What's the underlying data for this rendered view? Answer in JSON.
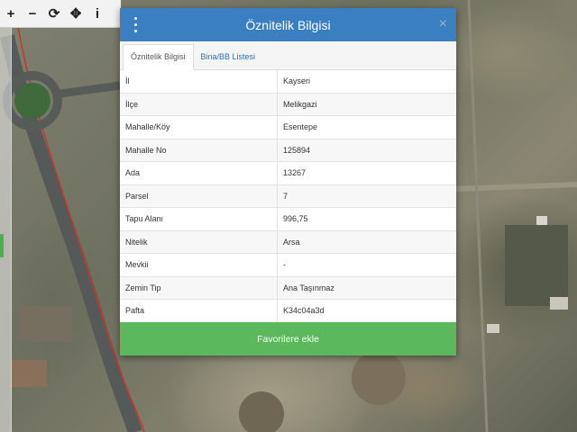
{
  "toolbar": {
    "zoom_in": "+",
    "zoom_out": "−",
    "refresh": "⟳",
    "locate": "✥",
    "info": "i"
  },
  "modal": {
    "title": "Öznitelik Bilgisi",
    "close": "×",
    "tabs": [
      {
        "label": "Öznitelik Bilgisi",
        "active": true
      },
      {
        "label": "Bina/BB Listesi",
        "active": false
      }
    ],
    "rows": [
      {
        "label": "İl",
        "value": "Kayseri"
      },
      {
        "label": "İlçe",
        "value": "Melikgazi"
      },
      {
        "label": "Mahalle/Köy",
        "value": "Esentepe"
      },
      {
        "label": "Mahalle No",
        "value": "125894"
      },
      {
        "label": "Ada",
        "value": "13267"
      },
      {
        "label": "Parsel",
        "value": "7"
      },
      {
        "label": "Tapu Alanı",
        "value": "996,75"
      },
      {
        "label": "Nitelik",
        "value": "Arsa"
      },
      {
        "label": "Mevkii",
        "value": "-"
      },
      {
        "label": "Zemin Tip",
        "value": "Ana Taşınmaz"
      },
      {
        "label": "Pafta",
        "value": "K34c04a3d"
      }
    ],
    "favorite_button": "Favorilere ekle"
  },
  "colors": {
    "header": "#3a7fc1",
    "button": "#5cb85c",
    "tab_link": "#2a6fb5"
  }
}
